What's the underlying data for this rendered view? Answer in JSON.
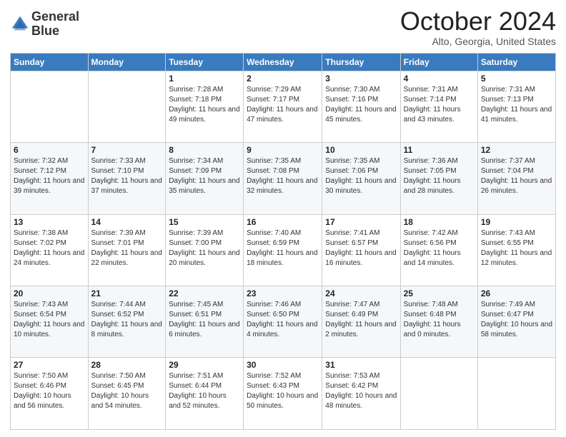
{
  "logo": {
    "line1": "General",
    "line2": "Blue"
  },
  "title": "October 2024",
  "location": "Alto, Georgia, United States",
  "days_of_week": [
    "Sunday",
    "Monday",
    "Tuesday",
    "Wednesday",
    "Thursday",
    "Friday",
    "Saturday"
  ],
  "weeks": [
    [
      {
        "day": "",
        "sunrise": "",
        "sunset": "",
        "daylight": ""
      },
      {
        "day": "",
        "sunrise": "",
        "sunset": "",
        "daylight": ""
      },
      {
        "day": "1",
        "sunrise": "Sunrise: 7:28 AM",
        "sunset": "Sunset: 7:18 PM",
        "daylight": "Daylight: 11 hours and 49 minutes."
      },
      {
        "day": "2",
        "sunrise": "Sunrise: 7:29 AM",
        "sunset": "Sunset: 7:17 PM",
        "daylight": "Daylight: 11 hours and 47 minutes."
      },
      {
        "day": "3",
        "sunrise": "Sunrise: 7:30 AM",
        "sunset": "Sunset: 7:16 PM",
        "daylight": "Daylight: 11 hours and 45 minutes."
      },
      {
        "day": "4",
        "sunrise": "Sunrise: 7:31 AM",
        "sunset": "Sunset: 7:14 PM",
        "daylight": "Daylight: 11 hours and 43 minutes."
      },
      {
        "day": "5",
        "sunrise": "Sunrise: 7:31 AM",
        "sunset": "Sunset: 7:13 PM",
        "daylight": "Daylight: 11 hours and 41 minutes."
      }
    ],
    [
      {
        "day": "6",
        "sunrise": "Sunrise: 7:32 AM",
        "sunset": "Sunset: 7:12 PM",
        "daylight": "Daylight: 11 hours and 39 minutes."
      },
      {
        "day": "7",
        "sunrise": "Sunrise: 7:33 AM",
        "sunset": "Sunset: 7:10 PM",
        "daylight": "Daylight: 11 hours and 37 minutes."
      },
      {
        "day": "8",
        "sunrise": "Sunrise: 7:34 AM",
        "sunset": "Sunset: 7:09 PM",
        "daylight": "Daylight: 11 hours and 35 minutes."
      },
      {
        "day": "9",
        "sunrise": "Sunrise: 7:35 AM",
        "sunset": "Sunset: 7:08 PM",
        "daylight": "Daylight: 11 hours and 32 minutes."
      },
      {
        "day": "10",
        "sunrise": "Sunrise: 7:35 AM",
        "sunset": "Sunset: 7:06 PM",
        "daylight": "Daylight: 11 hours and 30 minutes."
      },
      {
        "day": "11",
        "sunrise": "Sunrise: 7:36 AM",
        "sunset": "Sunset: 7:05 PM",
        "daylight": "Daylight: 11 hours and 28 minutes."
      },
      {
        "day": "12",
        "sunrise": "Sunrise: 7:37 AM",
        "sunset": "Sunset: 7:04 PM",
        "daylight": "Daylight: 11 hours and 26 minutes."
      }
    ],
    [
      {
        "day": "13",
        "sunrise": "Sunrise: 7:38 AM",
        "sunset": "Sunset: 7:02 PM",
        "daylight": "Daylight: 11 hours and 24 minutes."
      },
      {
        "day": "14",
        "sunrise": "Sunrise: 7:39 AM",
        "sunset": "Sunset: 7:01 PM",
        "daylight": "Daylight: 11 hours and 22 minutes."
      },
      {
        "day": "15",
        "sunrise": "Sunrise: 7:39 AM",
        "sunset": "Sunset: 7:00 PM",
        "daylight": "Daylight: 11 hours and 20 minutes."
      },
      {
        "day": "16",
        "sunrise": "Sunrise: 7:40 AM",
        "sunset": "Sunset: 6:59 PM",
        "daylight": "Daylight: 11 hours and 18 minutes."
      },
      {
        "day": "17",
        "sunrise": "Sunrise: 7:41 AM",
        "sunset": "Sunset: 6:57 PM",
        "daylight": "Daylight: 11 hours and 16 minutes."
      },
      {
        "day": "18",
        "sunrise": "Sunrise: 7:42 AM",
        "sunset": "Sunset: 6:56 PM",
        "daylight": "Daylight: 11 hours and 14 minutes."
      },
      {
        "day": "19",
        "sunrise": "Sunrise: 7:43 AM",
        "sunset": "Sunset: 6:55 PM",
        "daylight": "Daylight: 11 hours and 12 minutes."
      }
    ],
    [
      {
        "day": "20",
        "sunrise": "Sunrise: 7:43 AM",
        "sunset": "Sunset: 6:54 PM",
        "daylight": "Daylight: 11 hours and 10 minutes."
      },
      {
        "day": "21",
        "sunrise": "Sunrise: 7:44 AM",
        "sunset": "Sunset: 6:52 PM",
        "daylight": "Daylight: 11 hours and 8 minutes."
      },
      {
        "day": "22",
        "sunrise": "Sunrise: 7:45 AM",
        "sunset": "Sunset: 6:51 PM",
        "daylight": "Daylight: 11 hours and 6 minutes."
      },
      {
        "day": "23",
        "sunrise": "Sunrise: 7:46 AM",
        "sunset": "Sunset: 6:50 PM",
        "daylight": "Daylight: 11 hours and 4 minutes."
      },
      {
        "day": "24",
        "sunrise": "Sunrise: 7:47 AM",
        "sunset": "Sunset: 6:49 PM",
        "daylight": "Daylight: 11 hours and 2 minutes."
      },
      {
        "day": "25",
        "sunrise": "Sunrise: 7:48 AM",
        "sunset": "Sunset: 6:48 PM",
        "daylight": "Daylight: 11 hours and 0 minutes."
      },
      {
        "day": "26",
        "sunrise": "Sunrise: 7:49 AM",
        "sunset": "Sunset: 6:47 PM",
        "daylight": "Daylight: 10 hours and 58 minutes."
      }
    ],
    [
      {
        "day": "27",
        "sunrise": "Sunrise: 7:50 AM",
        "sunset": "Sunset: 6:46 PM",
        "daylight": "Daylight: 10 hours and 56 minutes."
      },
      {
        "day": "28",
        "sunrise": "Sunrise: 7:50 AM",
        "sunset": "Sunset: 6:45 PM",
        "daylight": "Daylight: 10 hours and 54 minutes."
      },
      {
        "day": "29",
        "sunrise": "Sunrise: 7:51 AM",
        "sunset": "Sunset: 6:44 PM",
        "daylight": "Daylight: 10 hours and 52 minutes."
      },
      {
        "day": "30",
        "sunrise": "Sunrise: 7:52 AM",
        "sunset": "Sunset: 6:43 PM",
        "daylight": "Daylight: 10 hours and 50 minutes."
      },
      {
        "day": "31",
        "sunrise": "Sunrise: 7:53 AM",
        "sunset": "Sunset: 6:42 PM",
        "daylight": "Daylight: 10 hours and 48 minutes."
      },
      {
        "day": "",
        "sunrise": "",
        "sunset": "",
        "daylight": ""
      },
      {
        "day": "",
        "sunrise": "",
        "sunset": "",
        "daylight": ""
      }
    ]
  ]
}
